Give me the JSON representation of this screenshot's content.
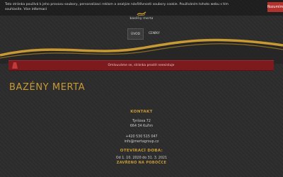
{
  "cookie_bar": {
    "text_line1": "Tato stránka používá k jeho provozu soubory, personalizaci reklam a analýze návštěvnosti soubory cookie. Používáním tohoto webu s tím",
    "text_line2": "souhlasíte.",
    "link_label": "Více informací",
    "accept_label": "Rozumím"
  },
  "logo": {
    "text": "bazény merta"
  },
  "nav": {
    "items": [
      {
        "label": "ÚVOD"
      },
      {
        "label": "CENÍKY"
      }
    ]
  },
  "error": {
    "message": "Omlouváme se, stránka prostě neexistuje"
  },
  "site": {
    "title": "BAZÉNY MERTA"
  },
  "contact": {
    "heading": "KONTAKT",
    "street": "Tyršova 72",
    "city": "664 34 Kuřim",
    "phone": "+420 530 515 047",
    "email": "info@mertagroup.cz"
  },
  "hours": {
    "heading": "OTEVÍRACÍ DOBA:",
    "period": "Od 1. 10. 2020 do 31. 3. 2021",
    "note": "ZAVŘENO NA POBOČCE"
  },
  "colors": {
    "accent": "#c99a33",
    "error": "#7d1a1e",
    "button": "#b3322d"
  }
}
